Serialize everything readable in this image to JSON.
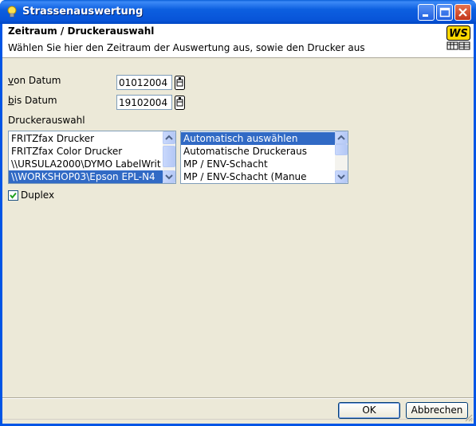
{
  "window": {
    "title": "Strassenauswertung"
  },
  "header": {
    "title": "Zeitraum / Druckerauswahl",
    "subtitle": "Wählen Sie hier den Zeitraum der Auswertung aus, sowie den Drucker aus",
    "logo_text": "WS"
  },
  "form": {
    "von_datum": {
      "accel": "v",
      "label_rest": "on Datum",
      "value": "01012004"
    },
    "bis_datum": {
      "accel": "b",
      "label_rest": "is Datum",
      "value": "19102004"
    },
    "druckerauswahl_label": "Druckerauswahl",
    "printers": [
      "FRITZfax Drucker",
      "FRITZfax Color Drucker",
      "\\\\URSULA2000\\DYMO LabelWrit",
      "\\\\WORKSHOP03\\Epson EPL-N4"
    ],
    "printer_selected_index": 3,
    "trays": [
      "Automatisch auswählen",
      "Automatische Druckeraus",
      "MP / ENV-Schacht",
      "MP / ENV-Schacht (Manue"
    ],
    "tray_selected_index": 0,
    "duplex": {
      "label": "Duplex",
      "checked": true
    }
  },
  "buttons": {
    "ok": "OK",
    "cancel": "Abbrechen"
  },
  "colors": {
    "titlebar": "#0055e5",
    "selection": "#316ac5",
    "dialog_bg": "#ece9d8",
    "check": "#21a121"
  }
}
